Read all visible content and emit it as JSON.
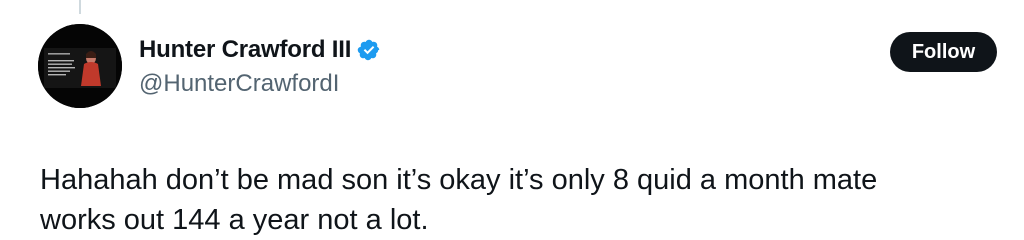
{
  "author": {
    "display_name": "Hunter Crawford III",
    "handle": "@HunterCrawfordI",
    "verified": true,
    "avatar_icon": "tv-still-avatar"
  },
  "actions": {
    "follow_label": "Follow"
  },
  "tweet": {
    "lines": [
      "Hahahah don’t be mad son it’s okay it’s only 8 quid a month mate",
      "works out 144 a year not a lot."
    ]
  },
  "colors": {
    "text_primary": "#0f1419",
    "text_secondary": "#536471",
    "verified_blue": "#1d9bf0",
    "button_bg": "#0f1419",
    "button_text": "#ffffff"
  }
}
